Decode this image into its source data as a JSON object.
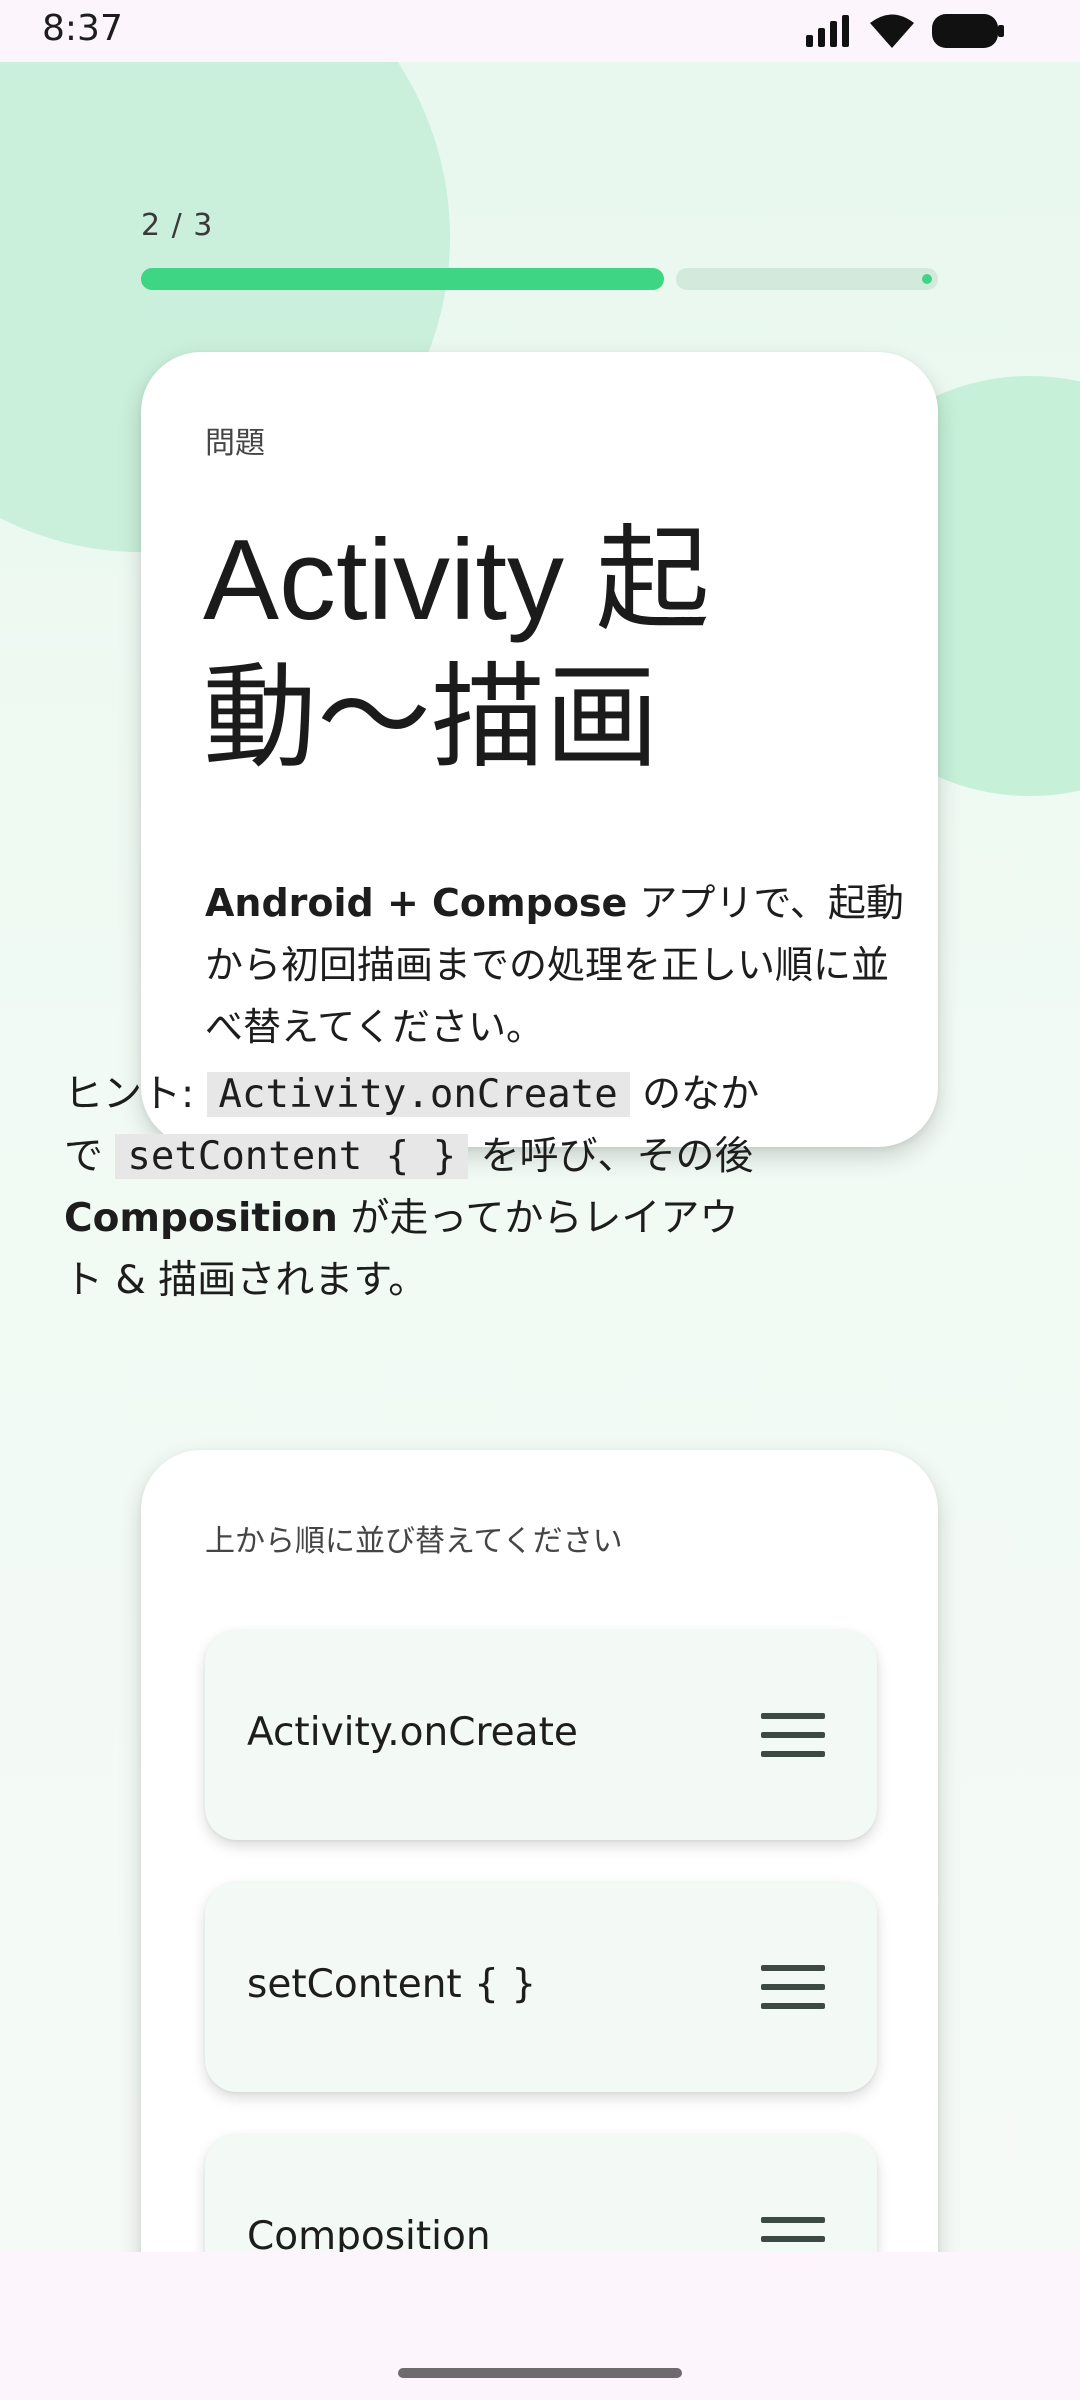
{
  "status_bar": {
    "time": "8:37",
    "icons": [
      "signal-icon",
      "wifi-icon",
      "battery-icon"
    ]
  },
  "progress": {
    "label": "2 / 3",
    "fraction": 0.6667,
    "fill_color": "#3ed684",
    "track_color": "#d3e9db"
  },
  "question": {
    "label": "問題",
    "title": "Activity 起動〜描画",
    "description": {
      "bold_prefix": "Android + Compose",
      "text": " アプリで、起動から初回描画までの処理を正しい順に並べ替えてください。"
    },
    "hint": {
      "prefix": "ヒント: ",
      "code1": "Activity.onCreate",
      "mid1": " のなかで ",
      "code2": "setContent { }",
      "mid2": " を呼び、その後 ",
      "bold": "Composition",
      "suffix": " が走ってからレイアウト & 描画されます。"
    }
  },
  "order": {
    "label": "上から順に並び替えてください",
    "items": [
      {
        "label": "Activity.onCreate",
        "handle_icon": "drag-handle-icon"
      },
      {
        "label": "setContent { }",
        "handle_icon": "drag-handle-icon"
      },
      {
        "label": "Composition",
        "handle_icon": "drag-handle-icon"
      }
    ]
  },
  "colors": {
    "accent": "#3ed684",
    "background": "#e8f8ee",
    "card": "#ffffff",
    "item_background": "#f3f9f5"
  }
}
